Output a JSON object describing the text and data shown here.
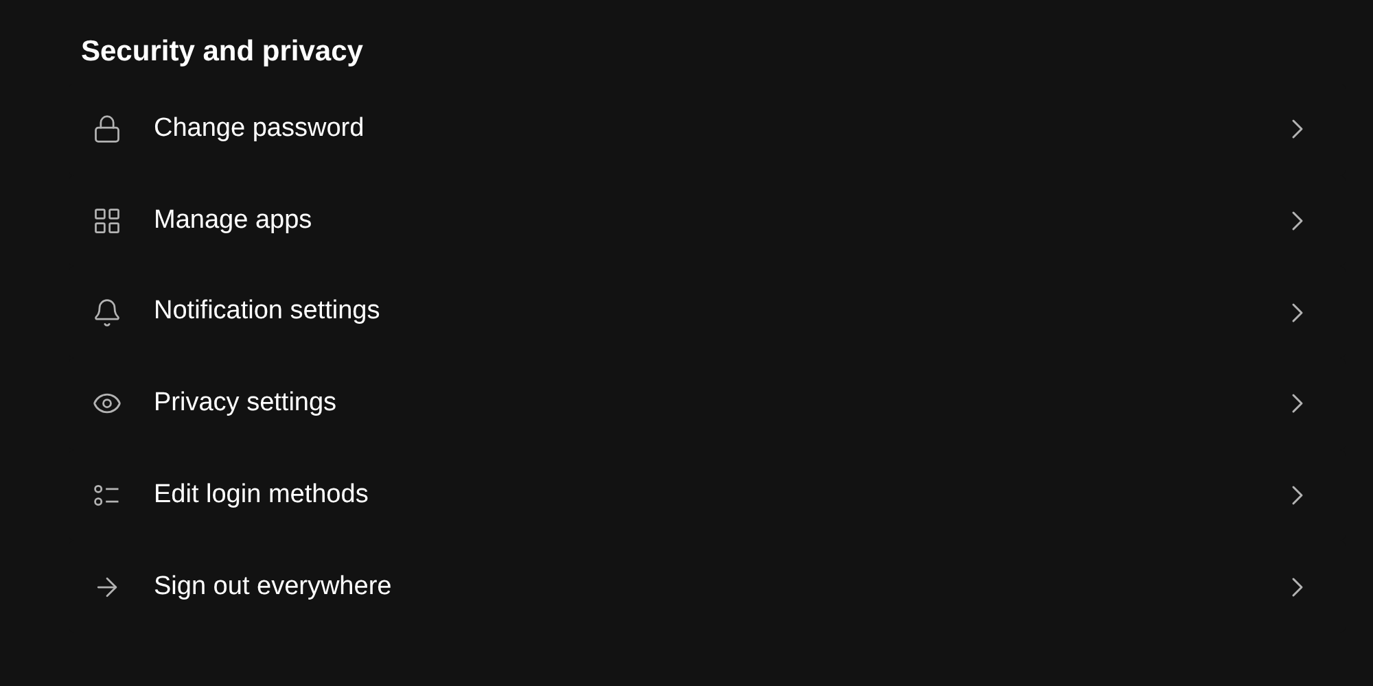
{
  "section": {
    "title": "Security and privacy"
  },
  "items": [
    {
      "label": "Change password"
    },
    {
      "label": "Manage apps"
    },
    {
      "label": "Notification settings"
    },
    {
      "label": "Privacy settings"
    },
    {
      "label": "Edit login methods"
    },
    {
      "label": "Sign out everywhere"
    }
  ]
}
